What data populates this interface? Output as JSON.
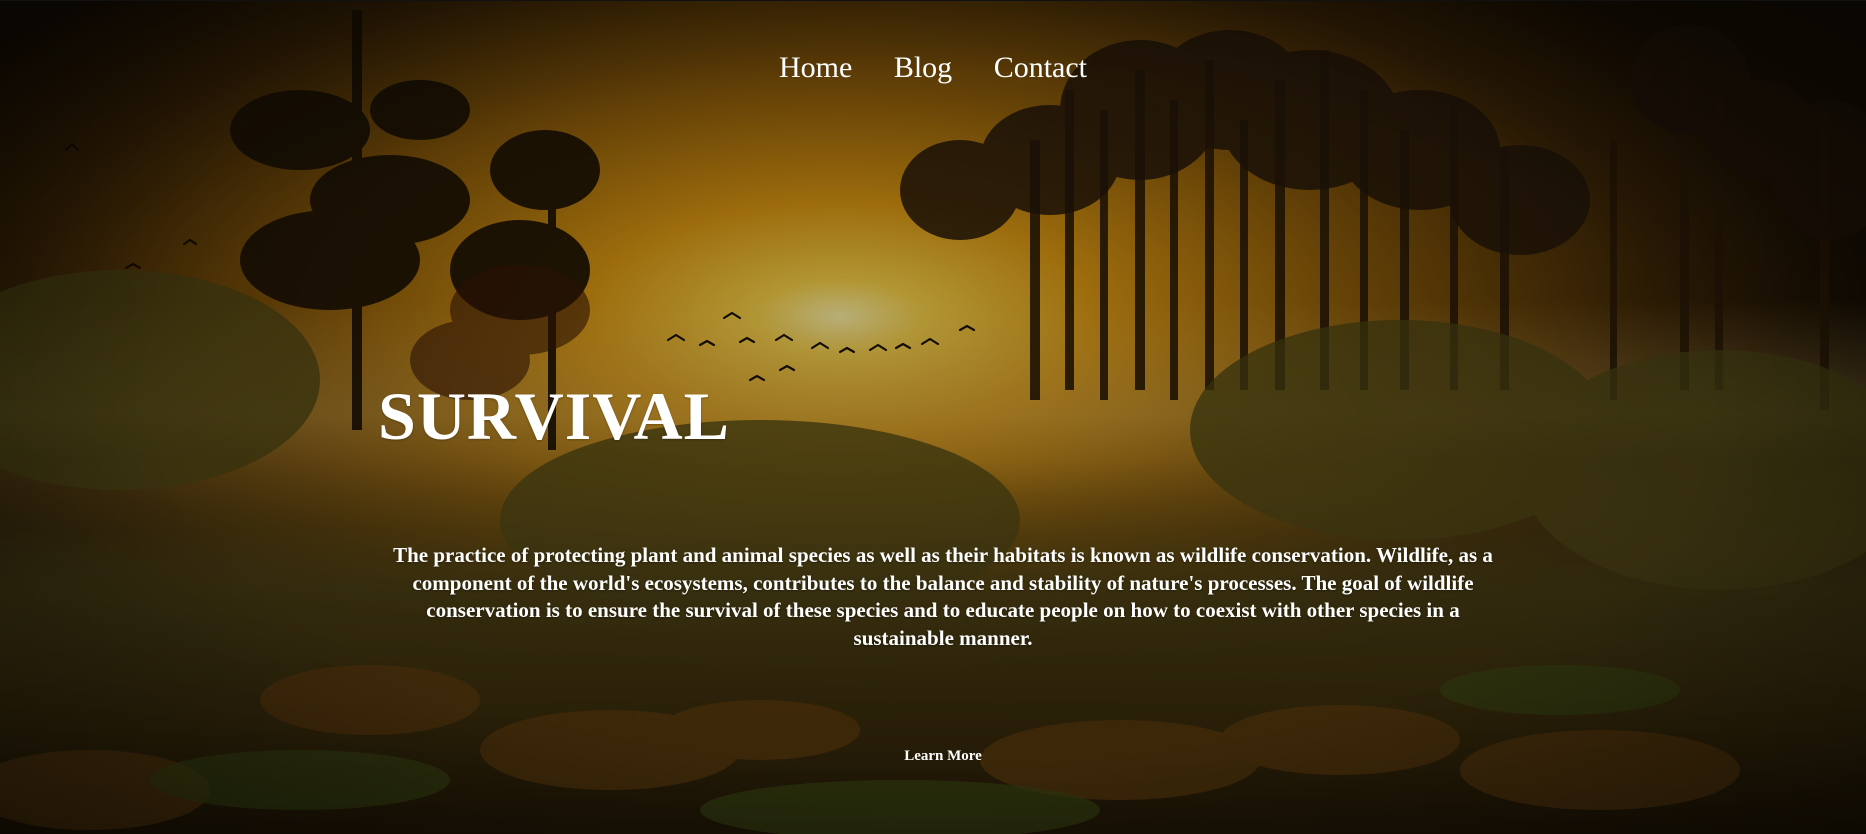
{
  "nav": {
    "items": [
      {
        "label": "Home"
      },
      {
        "label": "Blog"
      },
      {
        "label": "Contact"
      }
    ]
  },
  "hero": {
    "title": "SURVIVAL",
    "description": "The practice of protecting plant and animal species as well as their habitats is known as wildlife conservation. Wildlife, as a component of the world's ecosystems, contributes to the balance and stability of nature's processes. The goal of wildlife conservation is to ensure the survival of these species and to educate people on how to coexist with other species in a sustainable manner.",
    "button_label": "Learn More"
  },
  "colors": {
    "text": "#ffffff",
    "sky_glow": "#f7c436",
    "forest_dark": "#1c1405",
    "foliage": "#4a4a16"
  }
}
